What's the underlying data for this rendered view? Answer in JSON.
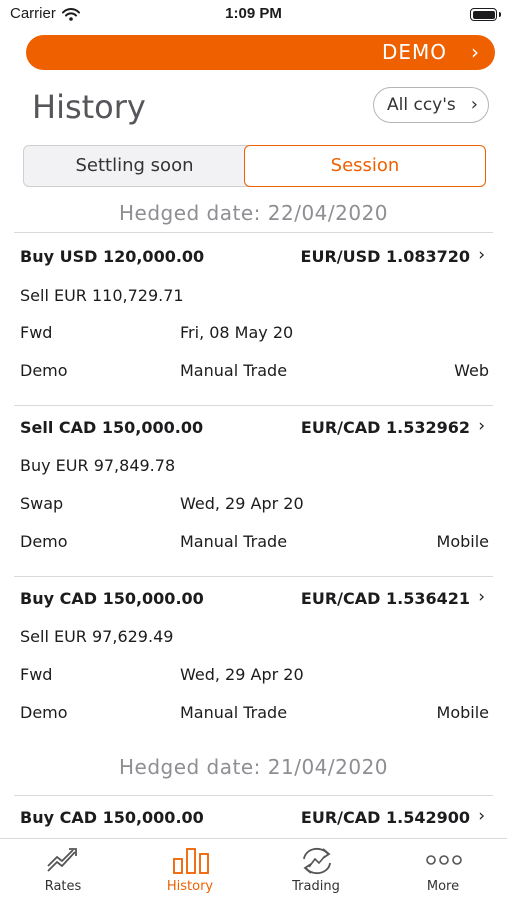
{
  "status_bar": {
    "carrier": "Carrier",
    "time": "1:09 PM"
  },
  "colors": {
    "accent": "#ef6100",
    "text_secondary": "#8e8e93"
  },
  "banner": {
    "label": "DEMO",
    "chevron": "›"
  },
  "header": {
    "title": "History",
    "filter_label": "All ccy's",
    "filter_chevron": "›"
  },
  "segments": {
    "settling_soon": "Settling soon",
    "session": "Session",
    "selected": "Session"
  },
  "sections": [
    {
      "header": "Hedged date: 22/04/2020",
      "trades": [
        {
          "leg1": "Buy USD 120,000.00",
          "pair": "EUR/USD 1.083720",
          "leg2": "Sell EUR 110,729.71",
          "product": "Fwd",
          "date": "Fri, 08 May 20",
          "account": "Demo",
          "trade_type": "Manual Trade",
          "channel": "Web"
        },
        {
          "leg1": "Sell CAD 150,000.00",
          "pair": "EUR/CAD 1.532962",
          "leg2": "Buy EUR 97,849.78",
          "product": "Swap",
          "date": "Wed, 29 Apr 20",
          "account": "Demo",
          "trade_type": "Manual Trade",
          "channel": "Mobile"
        },
        {
          "leg1": "Buy CAD 150,000.00",
          "pair": "EUR/CAD 1.536421",
          "leg2": "Sell EUR 97,629.49",
          "product": "Fwd",
          "date": "Wed, 29 Apr 20",
          "account": "Demo",
          "trade_type": "Manual Trade",
          "channel": "Mobile"
        }
      ]
    },
    {
      "header": "Hedged date: 21/04/2020",
      "trades": [
        {
          "leg1": "Buy CAD 150,000.00",
          "pair": "EUR/CAD 1.542900"
        }
      ]
    }
  ],
  "tabs": [
    {
      "label": "Rates",
      "icon": "rates-chart-icon",
      "active": false
    },
    {
      "label": "History",
      "icon": "bar-chart-icon",
      "active": true
    },
    {
      "label": "Trading",
      "icon": "trading-exchange-icon",
      "active": false
    },
    {
      "label": "More",
      "icon": "more-dots-icon",
      "active": false
    }
  ]
}
